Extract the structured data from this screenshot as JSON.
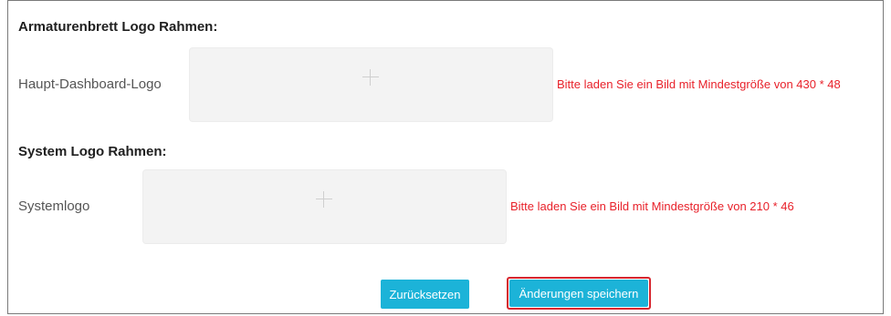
{
  "sections": {
    "dashboard": {
      "title": "Armaturenbrett Logo Rahmen:",
      "field_label": "Haupt-Dashboard-Logo",
      "hint": "Bitte laden Sie ein Bild mit Mindestgröße von 430 * 48",
      "upload_icon": "plus-icon"
    },
    "system": {
      "title": "System Logo Rahmen:",
      "field_label": "Systemlogo",
      "hint": "Bitte laden Sie ein Bild mit Mindestgröße von 210 * 46",
      "upload_icon": "plus-icon"
    }
  },
  "actions": {
    "reset_label": "Zurücksetzen",
    "save_label": "Änderungen speichern"
  },
  "colors": {
    "accent": "#1cb3d8",
    "hint": "#e8212a",
    "highlight_border": "#d7262e",
    "upload_bg": "#f3f3f3"
  }
}
